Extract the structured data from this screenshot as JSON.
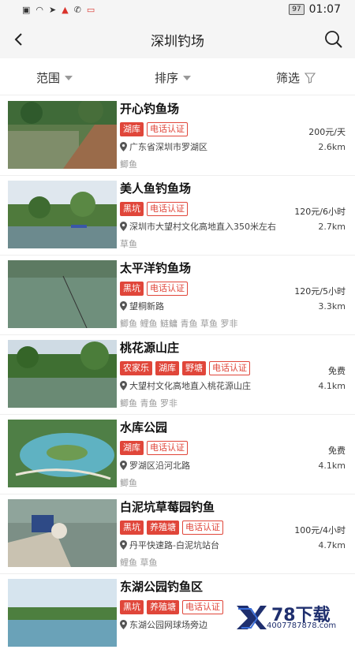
{
  "status": {
    "battery": "97",
    "time": "01:07"
  },
  "header": {
    "title": "深圳钓场"
  },
  "filters": [
    {
      "label": "范围"
    },
    {
      "label": "排序"
    },
    {
      "label": "筛选"
    }
  ],
  "spots": [
    {
      "name": "开心钓鱼场",
      "tags": [
        "湖库",
        "电话认证"
      ],
      "price": "200元/天",
      "location": "广东省深圳市罗湖区",
      "distance": "2.6km",
      "fish": "鲫鱼"
    },
    {
      "name": "美人鱼钓鱼场",
      "tags": [
        "黑坑",
        "电话认证"
      ],
      "price": "120元/6小时",
      "location": "深圳市大望村文化高地直入350米左右",
      "distance": "2.7km",
      "fish": "草鱼"
    },
    {
      "name": "太平洋钓鱼场",
      "tags": [
        "黑坑",
        "电话认证"
      ],
      "price": "120元/5小时",
      "location": "望桐新路",
      "distance": "3.3km",
      "fish": "鲫鱼 鲤鱼 鲢鳙 青鱼 草鱼 罗非"
    },
    {
      "name": "桃花源山庄",
      "tags": [
        "农家乐",
        "湖库",
        "野塘",
        "电话认证"
      ],
      "price": "免费",
      "location": "大望村文化高地直入桃花源山庄",
      "distance": "4.1km",
      "fish": "鲫鱼 青鱼 罗非"
    },
    {
      "name": "水库公园",
      "tags": [
        "湖库",
        "电话认证"
      ],
      "price": "免费",
      "location": "罗湖区沿河北路",
      "distance": "4.1km",
      "fish": "鲫鱼"
    },
    {
      "name": "白泥坑草莓园钓鱼",
      "tags": [
        "黑坑",
        "养殖塘",
        "电话认证"
      ],
      "price": "100元/4小时",
      "location": "丹平快速路-白泥坑站台",
      "distance": "4.7km",
      "fish": "鲤鱼 草鱼"
    },
    {
      "name": "东湖公园钓鱼区",
      "tags": [
        "黑坑",
        "养殖塘",
        "电话认证"
      ],
      "price": "",
      "location": "东湖公园网球场旁边",
      "distance": "",
      "fish": ""
    }
  ],
  "watermark": {
    "brand": "78下载",
    "url": "4007787878.com"
  },
  "colors": {
    "accent": "#e0463a",
    "background": "#ffffff",
    "bar": "#f5f5f5"
  }
}
